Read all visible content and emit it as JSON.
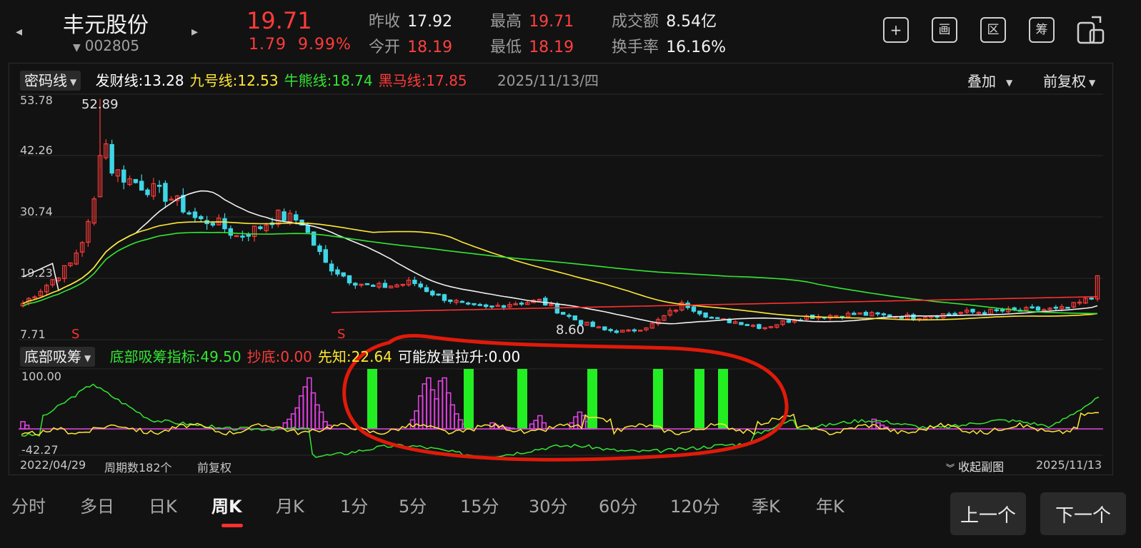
{
  "header": {
    "stock_name": "丰元股份",
    "stock_code": "002805",
    "price": "19.71",
    "change": "1.79",
    "change_pct": "9.99%",
    "prev_close_label": "昨收",
    "prev_close": "17.92",
    "open_label": "今开",
    "open": "18.19",
    "high_label": "最高",
    "high": "19.71",
    "low_label": "最低",
    "low": "18.19",
    "amount_label": "成交额",
    "amount": "8.54亿",
    "turnover_label": "换手率",
    "turnover": "16.16%",
    "icons": [
      "plus-square-icon",
      "draw-icon",
      "range-icon",
      "chip-icon",
      "orientation-icon"
    ],
    "icon_glyphs": [
      "+",
      "画",
      "区",
      "筹",
      ""
    ]
  },
  "main_chart": {
    "indicator": "密码线",
    "legend": [
      {
        "label": "发财线:",
        "value": "13.28",
        "color": "#ffffff"
      },
      {
        "label": "九号线:",
        "value": "12.53",
        "color": "#ffe833"
      },
      {
        "label": "牛熊线:",
        "value": "18.74",
        "color": "#33e633"
      },
      {
        "label": "黑马线:",
        "value": "17.85",
        "color": "#ff3b3b"
      }
    ],
    "date": "2025/11/13/四",
    "overlay_label": "叠加",
    "adjust_label": "前复权",
    "y_labels": [
      "53.78",
      "42.26",
      "30.74",
      "19.23",
      "7.71"
    ],
    "high_annotation": "52.89",
    "low_annotation": "8.60",
    "signal_mark": "S"
  },
  "sub_chart": {
    "indicator": "底部吸筹",
    "legend": [
      {
        "label": "底部吸筹指标:",
        "value": "49.50",
        "color": "#33e633"
      },
      {
        "label": "抄底:",
        "value": "0.00",
        "color": "#ff3b3b"
      },
      {
        "label": "先知:",
        "value": "22.64",
        "color": "#ffe833"
      },
      {
        "label": "可能放量拉升:",
        "value": "0.00",
        "color": "#ffffff"
      }
    ],
    "y_top": "100.00",
    "y_bottom": "-42.27"
  },
  "footer_info": {
    "start_date": "2022/04/29",
    "period_count": "周期数182个",
    "adjust": "前复权",
    "collapse_label": "收起副图",
    "end_date": "2025/11/13"
  },
  "tabs": [
    "分时",
    "多日",
    "日K",
    "周K",
    "月K",
    "1分",
    "5分",
    "15分",
    "30分",
    "60分",
    "120分",
    "季K",
    "年K"
  ],
  "active_tab": "周K",
  "prev_button": "上一个",
  "next_button": "下一个",
  "colors": {
    "up": "#ff3b3b",
    "down": "#3ed6e6",
    "bg": "#121212"
  }
}
